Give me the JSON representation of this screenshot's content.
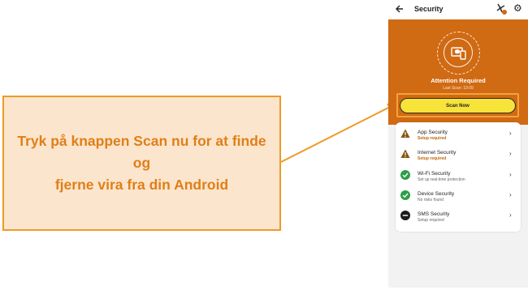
{
  "callout": {
    "line1": "Tryk på knappen Scan nu for at finde og",
    "line2": "fjerne vira fra din Android"
  },
  "app": {
    "title": "Security",
    "icons": [
      "back-arrow-icon",
      "fan-icon",
      "gear-icon"
    ]
  },
  "hero": {
    "status_title": "Attention Required",
    "last_scan": "Last Scan: 19:09",
    "scan_button_label": "Scan Now"
  },
  "items": [
    {
      "title": "App Security",
      "status": "Setup required",
      "state": "warning"
    },
    {
      "title": "Internet Security",
      "status": "Setup required",
      "state": "warning"
    },
    {
      "title": "Wi-Fi Security",
      "status": "Set up real-time protection",
      "state": "ok"
    },
    {
      "title": "Device Security",
      "status": "No risks found",
      "state": "ok"
    },
    {
      "title": "SMS Security",
      "status": "Setup required",
      "state": "blocked"
    }
  ],
  "colors": {
    "hero_orange": "#d06a13",
    "button_yellow": "#f7e33a",
    "callout_fill": "#fce5cd",
    "callout_text": "#e07f17",
    "ok_green": "#2e9d4a",
    "warning_brown": "#8a5310"
  }
}
